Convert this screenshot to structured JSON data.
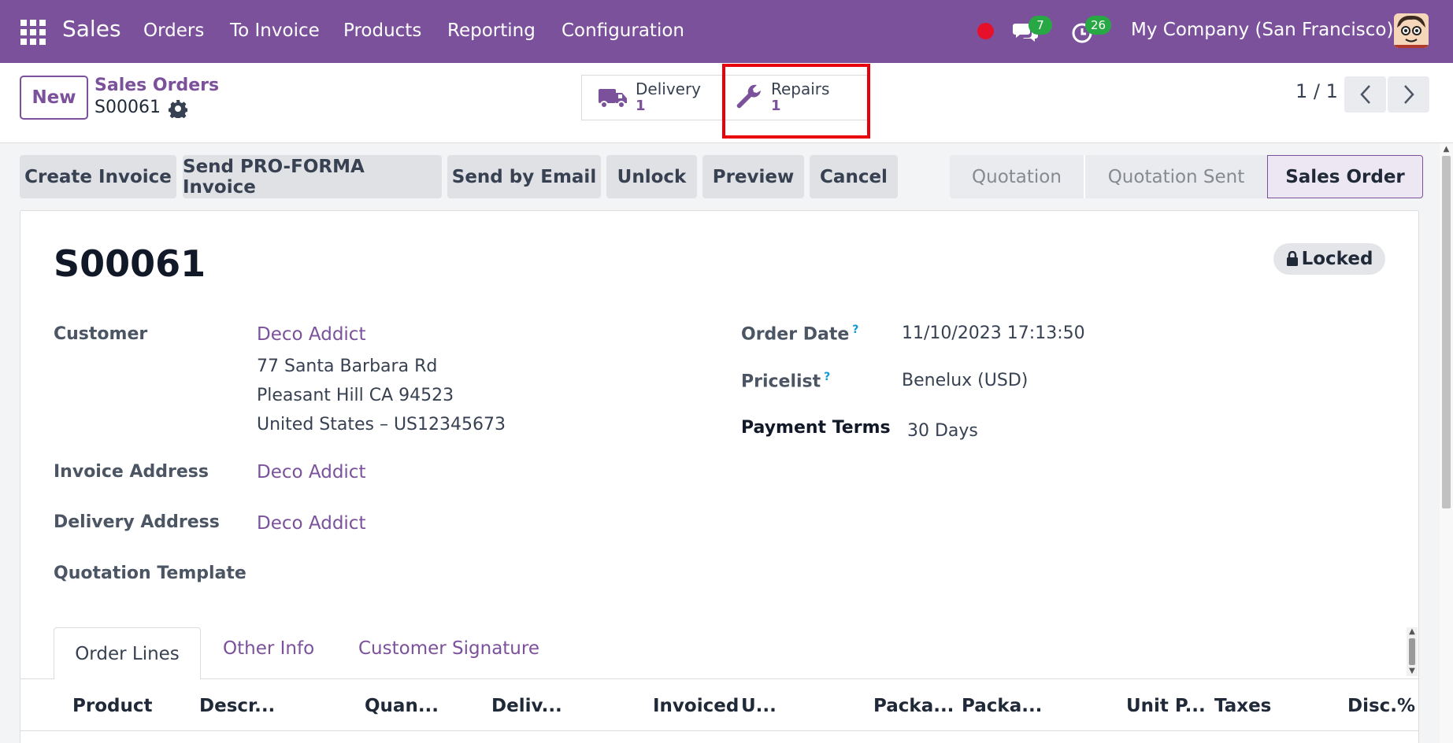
{
  "topbar": {
    "app_name": "Sales",
    "menu": [
      "Orders",
      "To Invoice",
      "Products",
      "Reporting",
      "Configuration"
    ],
    "messages_count": "7",
    "activities_count": "26",
    "company": "My Company (San Francisco)",
    "color": "#7c519b"
  },
  "controlbar": {
    "new_label": "New",
    "breadcrumb_parent": "Sales Orders",
    "breadcrumb_current": "S00061",
    "smart_buttons": [
      {
        "label": "Delivery",
        "count": "1",
        "icon": "truck-icon"
      },
      {
        "label": "Repairs",
        "count": "1",
        "icon": "wrench-icon"
      }
    ],
    "pager": "1 / 1"
  },
  "actions": [
    "Create Invoice",
    "Send PRO-FORMA Invoice",
    "Send by Email",
    "Unlock",
    "Preview",
    "Cancel"
  ],
  "status": {
    "stages": [
      "Quotation",
      "Quotation Sent",
      "Sales Order"
    ],
    "active": "Sales Order"
  },
  "form": {
    "title": "S00061",
    "locked_label": "Locked",
    "customer_label": "Customer",
    "customer_name": "Deco Addict",
    "customer_address": [
      "77 Santa Barbara Rd",
      "Pleasant Hill CA 94523",
      "United States – US12345673"
    ],
    "invoice_address_label": "Invoice Address",
    "invoice_address": "Deco Addict",
    "delivery_address_label": "Delivery Address",
    "delivery_address": "Deco Addict",
    "quotation_template_label": "Quotation Template",
    "order_date_label": "Order Date",
    "order_date": "11/10/2023 17:13:50",
    "pricelist_label": "Pricelist",
    "pricelist": "Benelux (USD)",
    "payment_terms_label": "Payment Terms",
    "payment_terms": "30 Days",
    "help_mark": "?"
  },
  "tabs": [
    "Order Lines",
    "Other Info",
    "Customer Signature"
  ],
  "table_headers": [
    "Product",
    "Descr...",
    "Quan...",
    "Deliv...",
    "Invoiced",
    "U...",
    "Packa...",
    "Packa...",
    "Unit P...",
    "Taxes",
    "Disc.%"
  ]
}
